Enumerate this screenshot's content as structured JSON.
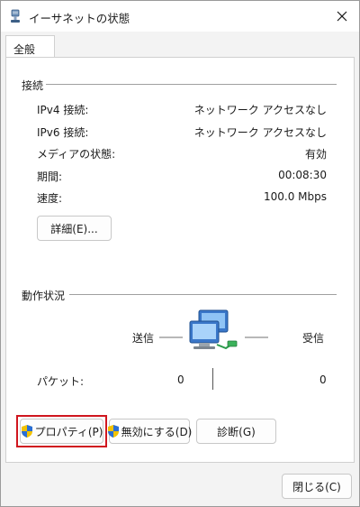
{
  "window": {
    "title": "イーサネットの状態",
    "icon": "network-adapter-icon",
    "close_icon": "close-icon"
  },
  "tabs": [
    {
      "label": "全般"
    }
  ],
  "connection": {
    "heading": "接続",
    "rows": [
      {
        "label": "IPv4 接続:",
        "value": "ネットワーク アクセスなし"
      },
      {
        "label": "IPv6 接続:",
        "value": "ネットワーク アクセスなし"
      },
      {
        "label": "メディアの状態:",
        "value": "有効"
      },
      {
        "label": "期間:",
        "value": "00:08:30"
      },
      {
        "label": "速度:",
        "value": "100.0 Mbps"
      }
    ],
    "details_button": "詳細(E)..."
  },
  "activity": {
    "heading": "動作状況",
    "sent_label": "送信",
    "received_label": "受信",
    "packets_label": "パケット:",
    "packets_sent": "0",
    "packets_received": "0",
    "icon": "network-computers-icon"
  },
  "actions": {
    "properties": "プロパティ(P)",
    "disable": "無効にする(D)",
    "diagnose": "診断(G)"
  },
  "footer": {
    "close": "閉じる(C)"
  },
  "colors": {
    "highlight": "#d0161f",
    "shield_blue": "#2a6fd6",
    "shield_yellow": "#f2c200"
  }
}
